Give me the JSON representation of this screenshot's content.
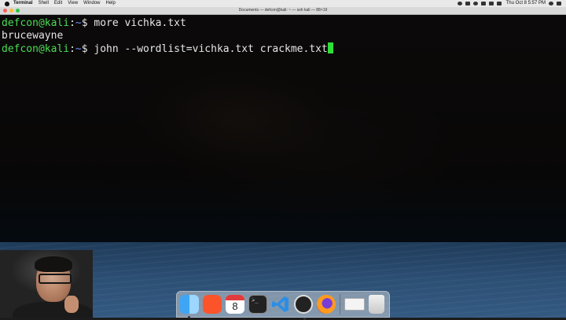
{
  "menubar": {
    "app_name": "Terminal",
    "items": [
      "Shell",
      "Edit",
      "View",
      "Window",
      "Help"
    ],
    "clock": "Thu Oct 8  5:57 PM"
  },
  "window": {
    "title": "Documents — defcon@kali: ~ — ssh kali — 88×19"
  },
  "terminal": {
    "lines": [
      {
        "user": "defcon@kali",
        "sep": ":",
        "path": "~",
        "prompt": "$ ",
        "command": "more vichka.txt"
      },
      {
        "output": "brucewayne"
      },
      {
        "user": "defcon@kali",
        "sep": ":",
        "path": "~",
        "prompt": "$ ",
        "command": "john --wordlist=vichka.txt crackme.txt"
      }
    ]
  },
  "dock": {
    "items": [
      "finder",
      "brave",
      "calendar",
      "terminal",
      "vscode",
      "obs",
      "firefox",
      "preview",
      "trash"
    ],
    "calendar_day": "8",
    "terminal_glyph": ">_"
  },
  "colors": {
    "prompt_user": "#4bdc53",
    "prompt_path": "#6e8eff",
    "cursor": "#2fe03a"
  }
}
